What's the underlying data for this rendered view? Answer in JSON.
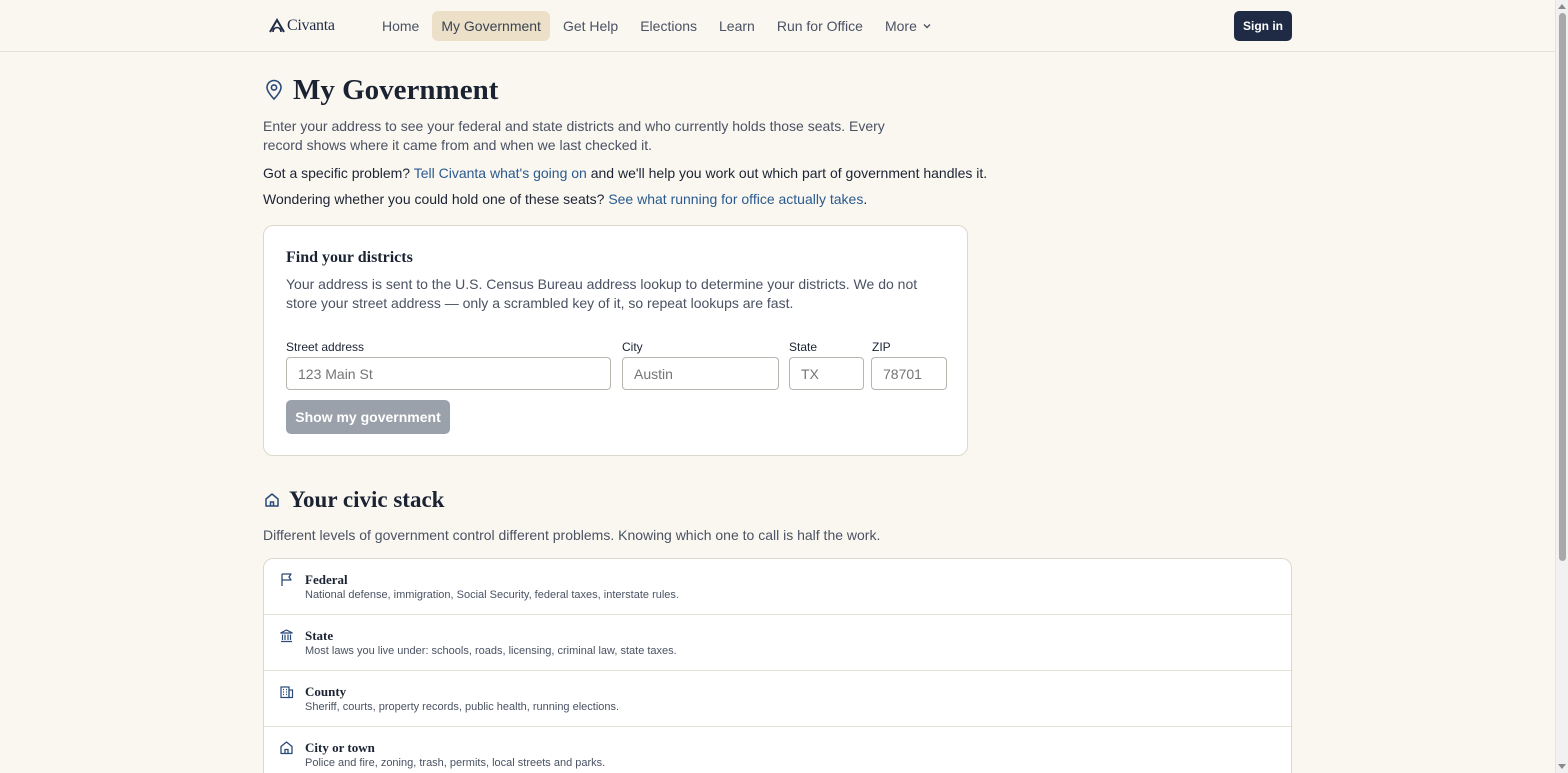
{
  "brand": {
    "name": "Civanta"
  },
  "nav": {
    "items": [
      {
        "label": "Home"
      },
      {
        "label": "My Government"
      },
      {
        "label": "Get Help"
      },
      {
        "label": "Elections"
      },
      {
        "label": "Learn"
      },
      {
        "label": "Run for Office"
      },
      {
        "label": "More"
      }
    ],
    "signin": "Sign in"
  },
  "page": {
    "title": "My Government",
    "intro": "Enter your address to see your federal and state districts and who currently holds those seats. Every record shows where it came from and when we last checked it.",
    "problem_prefix": "Got a specific problem? ",
    "problem_link": "Tell Civanta what's going on",
    "problem_suffix": " and we'll help you work out which part of government handles it.",
    "run_prefix": "Wondering whether you could hold one of these seats? ",
    "run_link": "See what running for office actually takes",
    "run_suffix": "."
  },
  "finder": {
    "title": "Find your districts",
    "description": "Your address is sent to the U.S. Census Bureau address lookup to determine your districts. We do not store your street address — only a scrambled key of it, so repeat lookups are fast.",
    "fields": {
      "street": {
        "label": "Street address",
        "placeholder": "123 Main St"
      },
      "city": {
        "label": "City",
        "placeholder": "Austin"
      },
      "state": {
        "label": "State",
        "placeholder": "TX"
      },
      "zip": {
        "label": "ZIP",
        "placeholder": "78701"
      }
    },
    "submit": "Show my government"
  },
  "civic_stack": {
    "title": "Your civic stack",
    "description": "Different levels of government control different problems. Knowing which one to call is half the work.",
    "levels": [
      {
        "name": "Federal",
        "desc": "National defense, immigration, Social Security, federal taxes, interstate rules.",
        "icon": "flag-icon"
      },
      {
        "name": "State",
        "desc": "Most laws you live under: schools, roads, licensing, criminal law, state taxes.",
        "icon": "landmark-icon"
      },
      {
        "name": "County",
        "desc": "Sheriff, courts, property records, public health, running elections.",
        "icon": "building-icon"
      },
      {
        "name": "City or town",
        "desc": "Police and fire, zoning, trash, permits, local streets and parks.",
        "icon": "home-icon"
      }
    ]
  },
  "colors": {
    "background": "#faf7f1",
    "primary": "#1f2a44",
    "link": "#2a5a8f",
    "nav_active": "#ece1c8",
    "button_disabled": "#9aa1ab"
  }
}
